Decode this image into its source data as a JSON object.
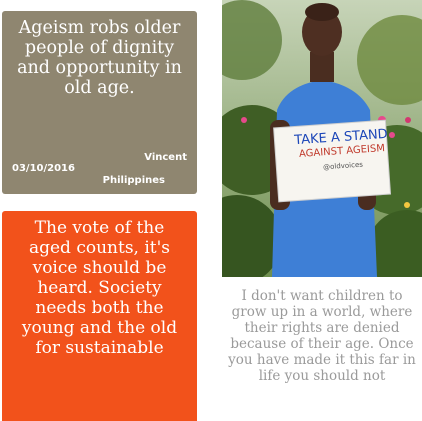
{
  "cards": [
    {
      "quote": "Ageism robs older people of dignity and opportunity in old age.",
      "author": "Vincent",
      "date": "03/10/2016",
      "country": "Philippines",
      "color": "#8f8670"
    },
    {
      "quote": "The vote of the aged counts, it's voice should be heard. Society needs both the young and the old for sustainable",
      "color": "#f2521b"
    }
  ],
  "photo_card": {
    "sign_line1": "TAKE A STAND",
    "sign_line2": "AGAINST AGEISM",
    "sign_line3": "@oldvoices",
    "quote": "I don't want children to grow up in a world, where their rights are denied because of their age. Once you have made it this far in life you should not"
  }
}
